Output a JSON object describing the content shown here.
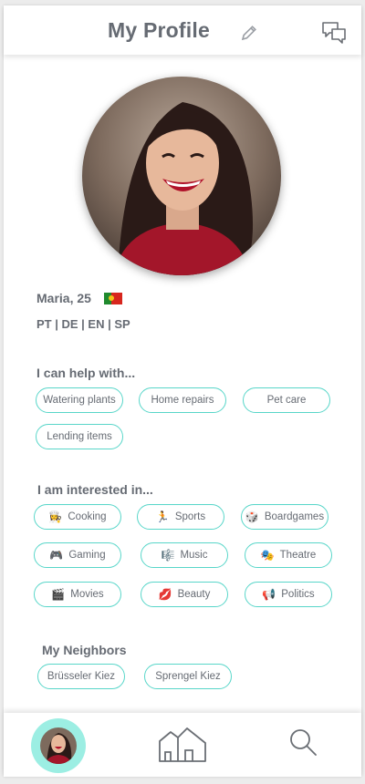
{
  "header": {
    "title": "My Profile",
    "edit_icon": "pencil-icon",
    "chat_icon": "chat-bubbles-icon"
  },
  "profile": {
    "name_age": "Maria, 25",
    "country_flag": "portugal-flag",
    "languages": "PT | DE | EN | SP"
  },
  "help": {
    "title": "I can help with...",
    "items": [
      "Watering plants",
      "Home repairs",
      "Pet care",
      "Lending items"
    ]
  },
  "interests": {
    "title": "I am interested in...",
    "items": [
      {
        "icon": "👩‍🍳",
        "label": "Cooking"
      },
      {
        "icon": "🏃",
        "label": "Sports"
      },
      {
        "icon": "🎲",
        "label": "Boardgames"
      },
      {
        "icon": "🎮",
        "label": "Gaming"
      },
      {
        "icon": "🎼",
        "label": "Music"
      },
      {
        "icon": "🎭",
        "label": "Theatre"
      },
      {
        "icon": "🎬",
        "label": "Movies"
      },
      {
        "icon": "💋",
        "label": "Beauty"
      },
      {
        "icon": "📢",
        "label": "Politics"
      }
    ]
  },
  "neighbors": {
    "title": "My Neighbors",
    "items": [
      "Brüsseler Kiez",
      "Sprengel Kiez"
    ]
  },
  "nav": {
    "profile_icon": "profile-avatar",
    "home_icon": "houses-icon",
    "search_icon": "search-icon"
  },
  "colors": {
    "accent": "#58d6c9",
    "text": "#666b73",
    "nav_active_bg": "#9ceee3"
  }
}
